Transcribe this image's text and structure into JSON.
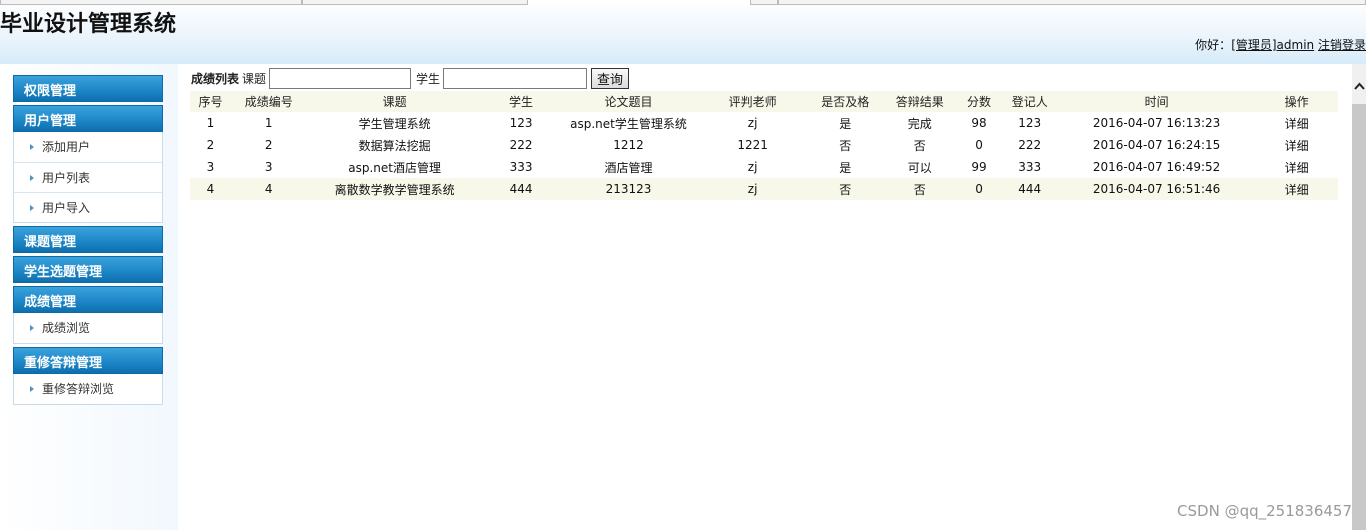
{
  "header": {
    "title": "毕业设计管理系统",
    "greeting": "你好：",
    "role_user": "[管理员]admin",
    "logout": "注销登录"
  },
  "sidebar": {
    "sections": [
      {
        "label": "权限管理",
        "items": []
      },
      {
        "label": "用户管理",
        "items": [
          "添加用户",
          "用户列表",
          "用户导入"
        ]
      },
      {
        "label": "课题管理",
        "items": []
      },
      {
        "label": "学生选题管理",
        "items": []
      },
      {
        "label": "成绩管理",
        "items": [
          "成绩浏览"
        ]
      },
      {
        "label": "重修答辩管理",
        "items": [
          "重修答辩浏览"
        ]
      }
    ]
  },
  "search": {
    "list_title": "成绩列表",
    "topic_label": "课题",
    "topic_value": "",
    "student_label": "学生",
    "student_value": "",
    "query_button": "查询"
  },
  "table": {
    "columns": [
      "序号",
      "成绩编号",
      "课题",
      "学生",
      "论文题目",
      "评判老师",
      "是否及格",
      "答辩结果",
      "分数",
      "登记人",
      "时间",
      "操作"
    ],
    "rows": [
      [
        "1",
        "1",
        "学生管理系统",
        "123",
        "asp.net学生管理系统",
        "zj",
        "是",
        "完成",
        "98",
        "123",
        "2016-04-07 16:13:23",
        "详细"
      ],
      [
        "2",
        "2",
        "数据算法挖掘",
        "222",
        "1212",
        "1221",
        "否",
        "否",
        "0",
        "222",
        "2016-04-07 16:24:15",
        "详细"
      ],
      [
        "3",
        "3",
        "asp.net酒店管理",
        "333",
        "酒店管理",
        "zj",
        "是",
        "可以",
        "99",
        "333",
        "2016-04-07 16:49:52",
        "详细"
      ],
      [
        "4",
        "4",
        "离散数学教学管理系统",
        "444",
        "213123",
        "zj",
        "否",
        "否",
        "0",
        "444",
        "2016-04-07 16:51:46",
        "详细"
      ]
    ]
  },
  "watermark": "CSDN @qq_251836457"
}
